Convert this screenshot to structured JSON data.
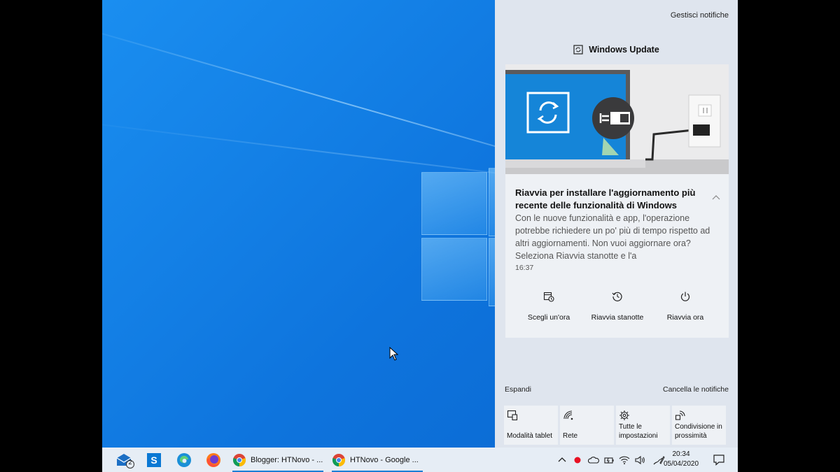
{
  "action_center": {
    "manage_notifications": "Gestisci notifiche",
    "group_title": "Windows Update",
    "notification": {
      "title": "Riavvia per installare l'aggiornamento più recente delle funzionalità di Windows",
      "body": "Con le nuove funzionalità e app, l'operazione potrebbe richiedere un po' più di tempo rispetto ad altri aggiornamenti. Non vuoi aggiornare ora? Seleziona Riavvia stanotte e l'a",
      "time": "16:37",
      "actions": [
        {
          "label": "Scegli un'ora",
          "icon": "calendar-clock-icon"
        },
        {
          "label": "Riavvia stanotte",
          "icon": "restart-clock-icon"
        },
        {
          "label": "Riavvia ora",
          "icon": "power-icon"
        }
      ]
    },
    "expand": "Espandi",
    "clear_all": "Cancella le notifiche",
    "quick_actions": [
      {
        "label": "Modalità tablet",
        "icon": "tablet-mode-icon"
      },
      {
        "label": "Rete",
        "icon": "network-icon"
      },
      {
        "label": "Tutte le impostazioni",
        "icon": "settings-gear-icon"
      },
      {
        "label": "Condivisione in prossimità",
        "icon": "nearby-share-icon"
      }
    ]
  },
  "taskbar": {
    "mail_badge": "2",
    "apps": [
      {
        "label": "Blogger: HTNovo - ...",
        "icon": "chrome-icon"
      },
      {
        "label": "HTNovo - Google ...",
        "icon": "chrome-icon"
      }
    ],
    "clock_time": "20:34",
    "clock_date": "05/04/2020"
  },
  "colors": {
    "accent": "#1b7fd6",
    "desktop_blue": "#0e74dd",
    "panel": "#dfe5ee"
  }
}
